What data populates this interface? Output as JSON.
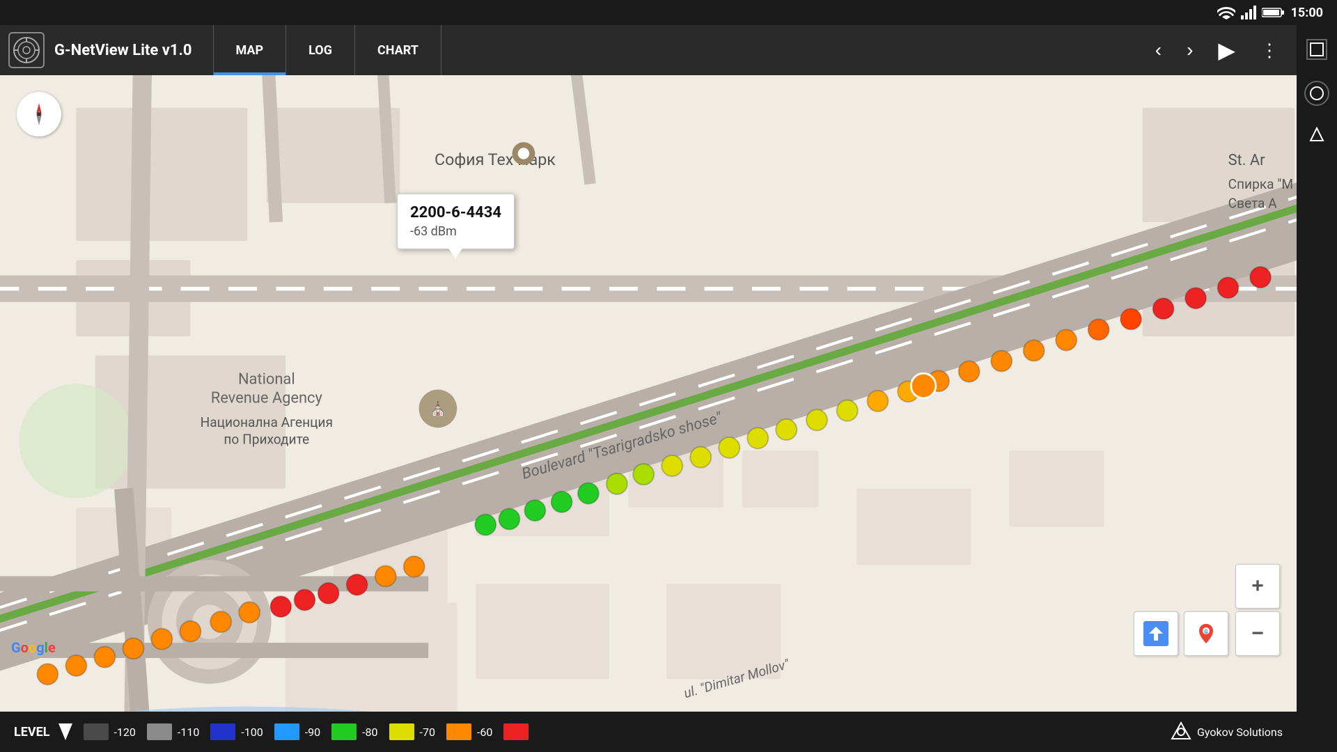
{
  "statusBar": {
    "time": "15:00"
  },
  "toolbar": {
    "appTitle": "G-NetView Lite v1.0",
    "tabs": [
      {
        "id": "map",
        "label": "MAP",
        "active": true
      },
      {
        "id": "log",
        "label": "LOG",
        "active": false
      },
      {
        "id": "chart",
        "label": "CHART",
        "active": false
      }
    ],
    "prevLabel": "‹",
    "nextLabel": "›",
    "playLabel": "▶",
    "moreLabel": "⋮"
  },
  "map": {
    "tooltip": {
      "title": "2200-6-4434",
      "value": "-63 dBm"
    },
    "labels": {
      "sofiaTechPark": "София Тех Парк",
      "nationalRevenueAgency": "National\nRevenue Agency",
      "nationalRevenueAgencyBg": "Национална Агенция\nпо Приходите",
      "boulevard": "Boulevard \"Tsarigradsko shose\"",
      "dimitar": "ul. \"Dimitar Mollov\"",
      "stAr": "St. Ar",
      "sparka": "Спирка \"М\nСвета А"
    },
    "zoomPlus": "+",
    "zoomMinus": "−",
    "googleLogo": "Google"
  },
  "legend": {
    "label": "LEVEL",
    "items": [
      {
        "color": "#4a4a4a",
        "value": "-120"
      },
      {
        "color": "#7a7a7a",
        "value": "-110"
      },
      {
        "color": "#2233cc",
        "value": "-100"
      },
      {
        "color": "#2299ff",
        "value": "-90"
      },
      {
        "color": "#22cc22",
        "value": "-80"
      },
      {
        "color": "#dddd00",
        "value": "-70"
      },
      {
        "color": "#ff8800",
        "value": "-60"
      },
      {
        "color": "#ee2222",
        "value": ""
      }
    ],
    "brandName": "Gyokov Solutions"
  }
}
